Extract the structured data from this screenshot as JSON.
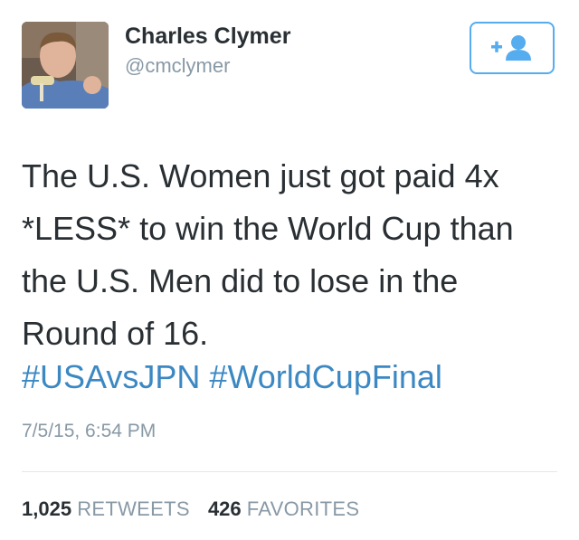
{
  "user": {
    "display_name": "Charles Clymer",
    "username": "@cmclymer"
  },
  "follow_button": {
    "icon": "add-user-icon",
    "color": "#55acee"
  },
  "tweet": {
    "text_lines": [
      "The U.S. Women just got paid 4x",
      "*LESS* to win the World Cup than",
      "the U.S. Men did to lose in the",
      "Round of 16."
    ],
    "hashtags": [
      "#USAvsJPN",
      "#WorldCupFinal"
    ],
    "timestamp": "7/5/15, 6:54 PM"
  },
  "stats": {
    "retweets_count": "1,025",
    "retweets_label": "RETWEETS",
    "favorites_count": "426",
    "favorites_label": "FAVORITES"
  },
  "colors": {
    "text": "#292f33",
    "secondary": "#8899a6",
    "link": "#3b88c3",
    "divider": "#e1e8ed"
  }
}
